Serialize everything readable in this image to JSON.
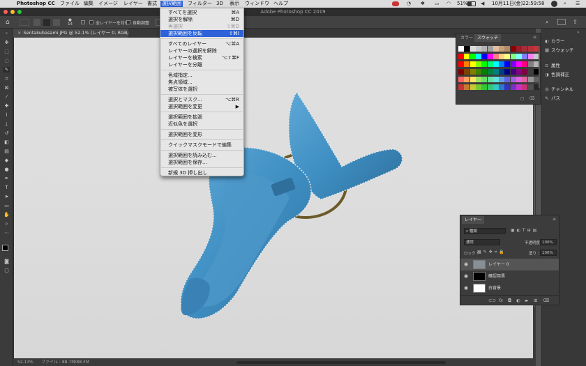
{
  "menubar": {
    "apple": "",
    "app": "Photoshop CC",
    "items": [
      "ファイル",
      "編集",
      "イメージ",
      "レイヤー",
      "書式",
      "選択範囲",
      "フィルター",
      "3D",
      "表示",
      "ウィンドウ",
      "ヘルプ"
    ],
    "active_index": 5,
    "battery": "51%",
    "date": "10月11日(金)",
    "time": "22:59:58"
  },
  "window": {
    "title": "Adobe Photoshop CC 2019"
  },
  "options": {
    "size_value": "14",
    "sample_all_label": "全レイヤーを対象",
    "auto_enhance_label": "自動調整"
  },
  "document": {
    "tab_title": "Sentakubasami.JPG @ 52.1% (レイヤー 0, RGB/8) *",
    "zoom": "52.13%",
    "file_info": "ファイル : 88.7M/88.7M"
  },
  "select_menu": {
    "items": [
      {
        "label": "すべてを選択",
        "shortcut": "⌘A",
        "state": "normal"
      },
      {
        "label": "選択を解除",
        "shortcut": "⌘D",
        "state": "normal"
      },
      {
        "label": "再選択",
        "shortcut": "⇧⌘D",
        "state": "disabled"
      },
      {
        "label": "選択範囲を反転",
        "shortcut": "⇧⌘I",
        "state": "highlighted"
      },
      {
        "label": "すべてのレイヤー",
        "shortcut": "⌥⌘A",
        "state": "normal"
      },
      {
        "label": "レイヤーの選択を解除",
        "shortcut": "",
        "state": "normal"
      },
      {
        "label": "レイヤーを検索",
        "shortcut": "⌥⇧⌘F",
        "state": "normal"
      },
      {
        "label": "レイヤーを分離",
        "shortcut": "",
        "state": "normal"
      },
      {
        "label": "色域指定...",
        "shortcut": "",
        "state": "normal"
      },
      {
        "label": "焦点領域...",
        "shortcut": "",
        "state": "normal"
      },
      {
        "label": "被写体を選択",
        "shortcut": "",
        "state": "normal"
      },
      {
        "label": "選択とマスク...",
        "shortcut": "⌥⌘R",
        "state": "normal"
      },
      {
        "label": "選択範囲を変更",
        "shortcut": "▶",
        "state": "normal"
      },
      {
        "label": "選択範囲を拡張",
        "shortcut": "",
        "state": "normal"
      },
      {
        "label": "近似色を選択",
        "shortcut": "",
        "state": "normal"
      },
      {
        "label": "選択範囲を変形",
        "shortcut": "",
        "state": "normal"
      },
      {
        "label": "クイックマスクモードで編集",
        "shortcut": "",
        "state": "normal"
      },
      {
        "label": "選択範囲を読み込む...",
        "shortcut": "",
        "state": "normal"
      },
      {
        "label": "選択範囲を保存...",
        "shortcut": "",
        "state": "normal"
      },
      {
        "label": "新規 3D 押し出し",
        "shortcut": "",
        "state": "normal"
      }
    ]
  },
  "swatch_panel": {
    "tabs": [
      "カラー",
      "スウォッチ"
    ],
    "active_tab": 1,
    "colors": [
      [
        "#ffffff",
        "#000000",
        "#dcdcdc",
        "#c8c8c8",
        "#b4b4b4",
        "#a0a0a0",
        "#e1bea0",
        "#c8a078",
        "#af8c64",
        "#8c0000",
        "#9b1e28",
        "#aa2d3c",
        "#b4323c",
        "#c8323c"
      ],
      [
        "#ff0000",
        "#ffff00",
        "#00ff00",
        "#00ffff",
        "#0000ff",
        "#ff00ff",
        "#ff8080",
        "#ffd280",
        "#ffff80",
        "#80ff80",
        "#80ffff",
        "#8080ff",
        "#ff80ff",
        "#c8c8c8"
      ],
      [
        "#ff0000",
        "#ff8000",
        "#ffff00",
        "#80ff00",
        "#00ff00",
        "#00ff80",
        "#00ffff",
        "#0080ff",
        "#0000ff",
        "#8000ff",
        "#ff00ff",
        "#ff0080",
        "#808080",
        "#b4b4b4"
      ],
      [
        "#800000",
        "#804000",
        "#808000",
        "#408000",
        "#008000",
        "#008040",
        "#008080",
        "#004080",
        "#000080",
        "#400080",
        "#800080",
        "#800040",
        "#404040",
        "#000000"
      ],
      [
        "#ff6464",
        "#ffa064",
        "#ffe164",
        "#a0e164",
        "#64e164",
        "#64e1a0",
        "#64e1e1",
        "#64a0e1",
        "#6464e1",
        "#a064e1",
        "#e164e1",
        "#e164a0",
        "#969696",
        "#646464"
      ],
      [
        "#c83232",
        "#c87832",
        "#c8c832",
        "#78c832",
        "#32c832",
        "#32c878",
        "#32c8c8",
        "#3278c8",
        "#3232c8",
        "#7832c8",
        "#c832c8",
        "#c83278",
        "#505050",
        "#282828"
      ]
    ]
  },
  "right_dock": {
    "items": [
      {
        "icon": "color-icon",
        "glyph": "◐",
        "label": "カラー"
      },
      {
        "icon": "swatches-icon",
        "glyph": "▦",
        "label": "スウォッチ"
      },
      {
        "icon": "properties-icon",
        "glyph": "≡",
        "label": "属性"
      },
      {
        "icon": "adjustments-icon",
        "glyph": "◑",
        "label": "色調補正"
      },
      {
        "icon": "channels-icon",
        "glyph": "◎",
        "label": "チャンネル"
      },
      {
        "icon": "paths-icon",
        "glyph": "✎",
        "label": "パス"
      }
    ]
  },
  "layers_panel": {
    "title": "レイヤー",
    "filter_kind": "種類",
    "blend_mode": "通常",
    "opacity_label": "不透明度 :",
    "opacity_value": "100%",
    "lock_label": "ロック :",
    "fill_label": "塗り :",
    "fill_value": "100%",
    "layers": [
      {
        "name": "レイヤー 0",
        "thumb": "#8a8f94",
        "selected": true
      },
      {
        "name": "確認用黒",
        "thumb": "#000000",
        "selected": false
      },
      {
        "name": "白背景",
        "thumb": "#ffffff",
        "selected": false
      }
    ],
    "footer_icons": [
      "link-icon",
      "fx-icon",
      "mask-icon",
      "adjustment-icon",
      "group-icon",
      "new-layer-icon",
      "trash-icon"
    ]
  },
  "tools": [
    "移動",
    "選択",
    "なげなわ",
    "クイック選択",
    "切り抜き",
    "フレーム",
    "スポイト",
    "修復",
    "ブラシ",
    "スタンプ",
    "ヒストリー",
    "消しゴム",
    "グラデーション",
    "ぼかし",
    "覆い焼き",
    "ペン",
    "文字",
    "パス選択",
    "シェイプ",
    "手のひら",
    "ズーム"
  ]
}
